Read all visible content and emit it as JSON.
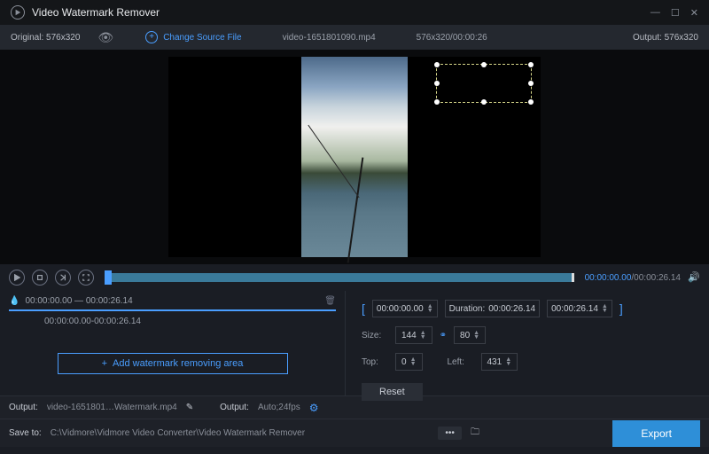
{
  "title": "Video Watermark Remover",
  "topbar": {
    "original_label": "Original:",
    "original_dim": "576x320",
    "change_source": "Change Source File",
    "filename": "video-1651801090.mp4",
    "fileinfo": "576x320/00:00:26",
    "output_label": "Output:",
    "output_dim": "576x320"
  },
  "playback": {
    "current": "00:00:00.00",
    "total": "/00:00:26.14"
  },
  "segment": {
    "range": "00:00:00.00 — 00:00:26.14",
    "item": "00:00:00.00-00:00:26.14",
    "add_label": "Add watermark removing area"
  },
  "controls": {
    "start": "00:00:00.00",
    "duration_label": "Duration:",
    "duration": "00:00:26.14",
    "end": "00:00:26.14",
    "size_label": "Size:",
    "size_w": "144",
    "size_h": "80",
    "top_label": "Top:",
    "top_val": "0",
    "left_label": "Left:",
    "left_val": "431",
    "reset": "Reset"
  },
  "bottom": {
    "output1_label": "Output:",
    "output1_val": "video-1651801…Watermark.mp4",
    "output2_label": "Output:",
    "output2_val": "Auto;24fps",
    "save_label": "Save to:",
    "save_path": "C:\\Vidmore\\Vidmore Video Converter\\Video Watermark Remover",
    "export": "Export"
  }
}
